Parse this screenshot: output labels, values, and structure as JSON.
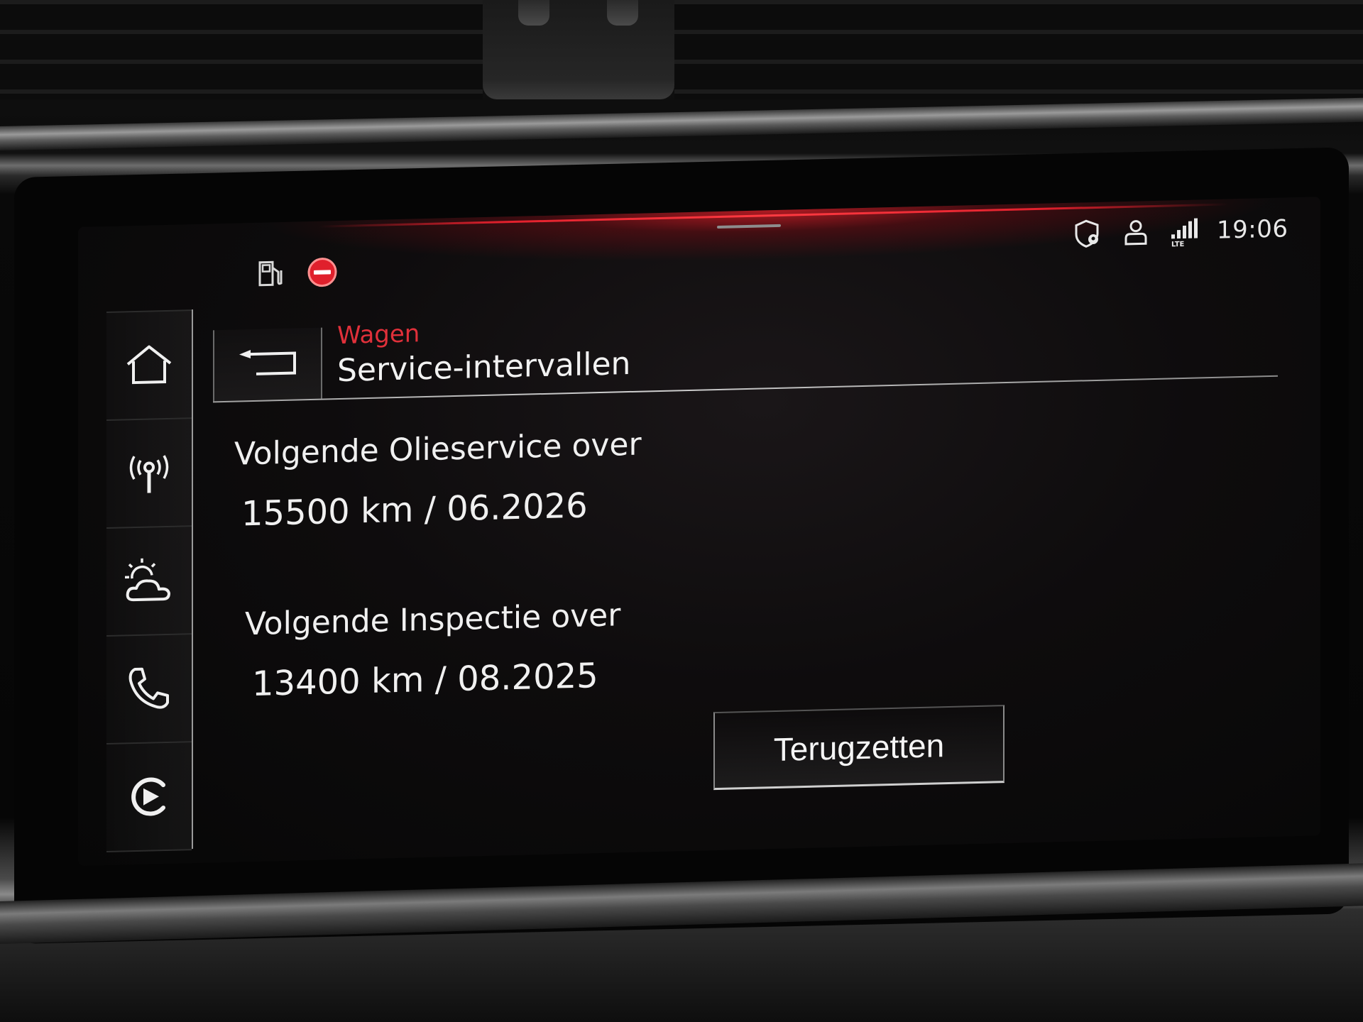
{
  "status_bar": {
    "clock": "19:06",
    "left_icons": [
      "fuel-pump-icon",
      "no-entry-icon"
    ],
    "right_icons": [
      "location-shield-icon",
      "user-profile-icon",
      "lte-signal-icon"
    ],
    "lte_label": "LTE",
    "accent_red": "#e0202c"
  },
  "sidebar": {
    "items": [
      {
        "icon": "home-icon"
      },
      {
        "icon": "radio-antenna-icon"
      },
      {
        "icon": "weather-icon"
      },
      {
        "icon": "phone-icon"
      },
      {
        "icon": "media-play-icon"
      }
    ]
  },
  "header": {
    "breadcrumb": "Wagen",
    "title": "Service-intervallen",
    "back_icon": "back-arrow-icon"
  },
  "service": {
    "oil": {
      "label": "Volgende Olieservice over",
      "value": "15500 km / 06.2026"
    },
    "inspection": {
      "label": "Volgende Inspectie over",
      "value": "13400 km / 08.2025"
    },
    "reset_label": "Terugzetten"
  }
}
